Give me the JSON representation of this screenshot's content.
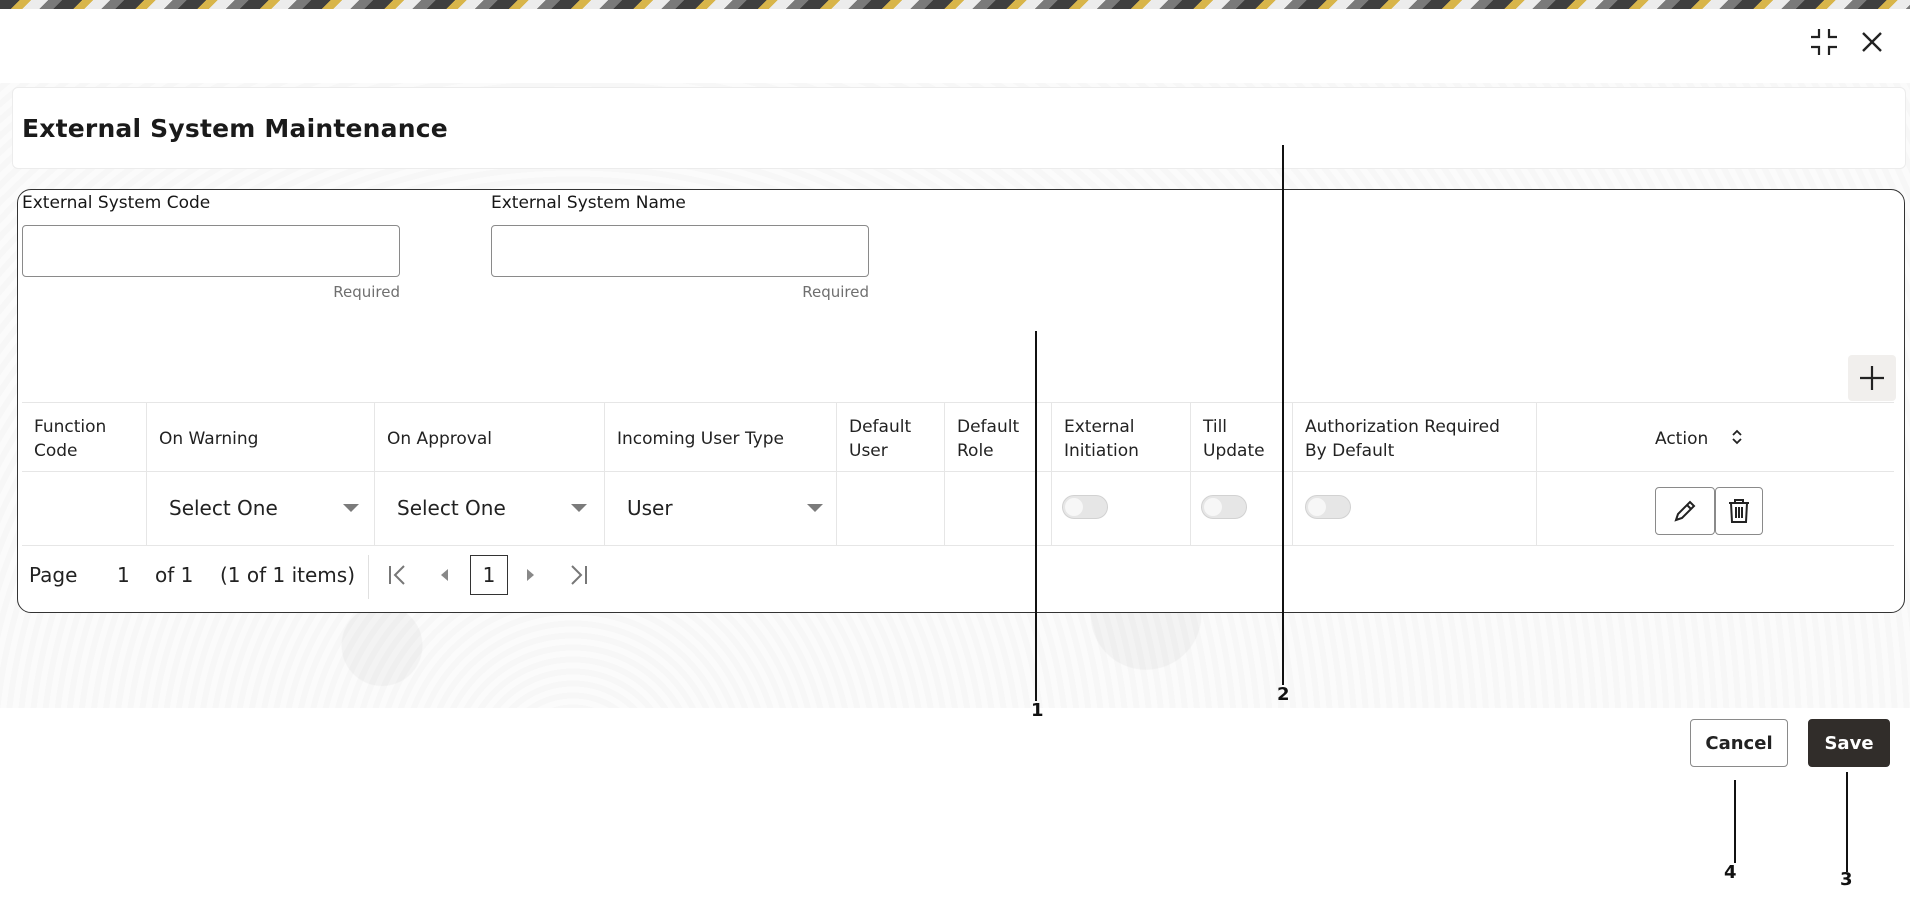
{
  "header": {
    "restore_icon": "restore-icon",
    "close_icon": "close-icon"
  },
  "page": {
    "title": "External System Maintenance"
  },
  "form": {
    "code_label": "External System Code",
    "code_value": "",
    "code_hint": "Required",
    "name_label": "External System Name",
    "name_value": "",
    "name_hint": "Required"
  },
  "grid": {
    "columns": [
      "Function Code",
      "On Warning",
      "On Approval",
      "Incoming User Type",
      "Default User",
      "Default Role",
      "External Initiation",
      "Till Update",
      "Authorization Required By Default",
      "Action"
    ],
    "rows": [
      {
        "function_code": "",
        "on_warning": "Select One",
        "on_approval": "Select One",
        "incoming_user_type": "User",
        "default_user": "",
        "default_role": "",
        "external_initiation": false,
        "till_update": false,
        "authorization_required": false
      }
    ]
  },
  "pagination": {
    "page_label": "Page",
    "page_value": "1",
    "of_label": "of 1",
    "items_label": "(1 of 1 items)",
    "current": "1"
  },
  "callouts": [
    "1",
    "2",
    "3",
    "4"
  ],
  "footer": {
    "cancel_label": "Cancel",
    "save_label": "Save"
  },
  "colors": {
    "save_bg": "#312d2a",
    "border_dark": "#333333"
  }
}
